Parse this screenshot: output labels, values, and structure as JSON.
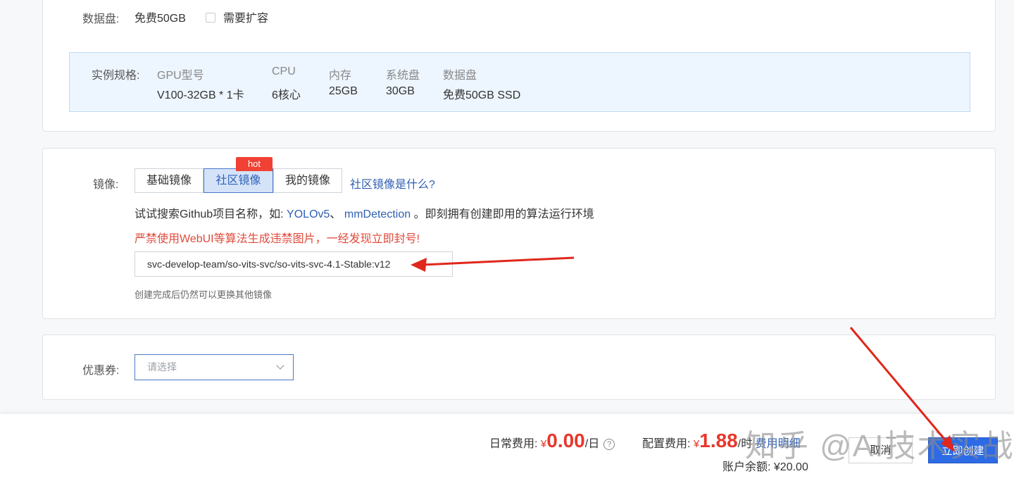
{
  "data_disk": {
    "label": "数据盘:",
    "value": "免费50GB",
    "expand_label": "需要扩容"
  },
  "spec": {
    "label": "实例规格:",
    "columns": [
      {
        "header": "GPU型号",
        "value": "V100-32GB * 1卡"
      },
      {
        "header": "CPU",
        "value": "6核心"
      },
      {
        "header": "内存",
        "value": "25GB"
      },
      {
        "header": "系统盘",
        "value": "30GB"
      },
      {
        "header": "数据盘",
        "value": "免费50GB SSD"
      }
    ]
  },
  "image": {
    "label": "镜像:",
    "tabs": [
      "基础镜像",
      "社区镜像",
      "我的镜像"
    ],
    "active_tab": "社区镜像",
    "hot_badge": "hot",
    "help_link": "社区镜像是什么?",
    "search_hint_prefix": "试试搜索Github项目名称，如:",
    "example_1": "YOLOv5",
    "separator": "、",
    "example_2": "mmDetection",
    "search_hint_suffix": "。即刻拥有创建即用的算法运行环境",
    "warning": "严禁使用WebUI等算法生成违禁图片，一经发现立即封号!",
    "selected_value": "svc-develop-team/so-vits-svc/so-vits-svc-4.1-Stable:v12",
    "note": "创建完成后仍然可以更换其他镜像"
  },
  "coupon": {
    "label": "优惠券:",
    "placeholder": "请选择"
  },
  "footer": {
    "daily_fee_label": "日常费用:",
    "daily_fee_currency": "¥",
    "daily_fee_value": "0.00",
    "daily_fee_unit": "/日",
    "config_fee_label": "配置费用:",
    "config_fee_currency": "¥",
    "config_fee_value": "1.88",
    "config_fee_unit": "/时",
    "fee_detail_link": "费用明细",
    "balance_label": "账户余额:",
    "balance_value": "¥20.00",
    "cancel_label": "取消",
    "create_label": "立即创建",
    "watermark": "知乎 @AI技术实战"
  },
  "colors": {
    "accent": "#2d6be6",
    "price": "#e8372b",
    "annotation_arrow": "#e0271b"
  }
}
